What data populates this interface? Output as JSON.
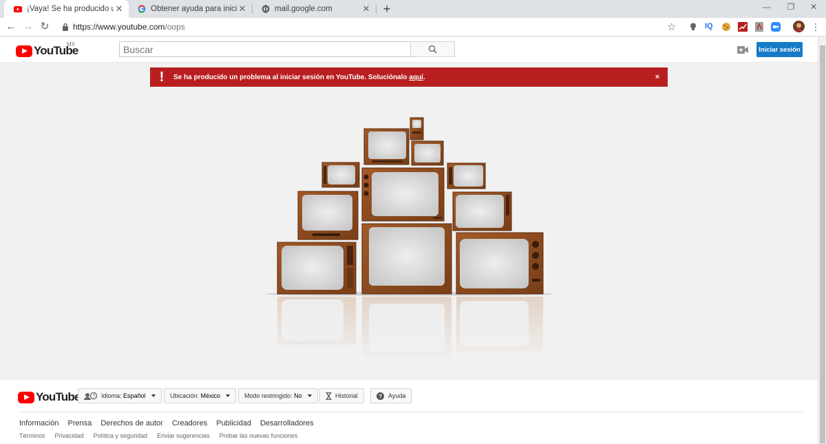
{
  "browser": {
    "tabs": [
      {
        "title": "¡Vaya! Se ha producido un error",
        "icon": "youtube-icon",
        "active": true
      },
      {
        "title": "Obtener ayuda para iniciar sesión",
        "icon": "google-icon",
        "active": false
      },
      {
        "title": "mail.google.com",
        "icon": "globe-icon",
        "active": false
      }
    ],
    "new_tab": "+",
    "url_main": "https://www.youtube.com",
    "url_path": "/oops",
    "extensions": [
      "lightbulb-icon",
      "iq-icon",
      "cookie-icon",
      "chart-icon",
      "pdf-icon",
      "zoom-icon",
      "avatar-icon"
    ],
    "ext_iq_label": "IQ"
  },
  "masthead": {
    "logo_word": "YouTube",
    "country": "MX",
    "search_placeholder": "Buscar",
    "signin_label": "Iniciar sesión"
  },
  "banner": {
    "icon": "!",
    "message_prefix": "Se ha producido un problema al iniciar sesión en YouTube. Soluciónalo ",
    "message_link": "aquí",
    "message_suffix": ".",
    "close": "×",
    "color": "#b91f20"
  },
  "footer": {
    "logo_word": "YouTube",
    "language_label": "Idioma:",
    "language_value": "Español",
    "location_label": "Ubicación:",
    "location_value": "México",
    "restricted_label": "Modo restringido:",
    "restricted_value": "No",
    "history_label": "Historial",
    "help_label": "Ayuda",
    "primary_links": [
      "Información",
      "Prensa",
      "Derechos de autor",
      "Creadores",
      "Publicidad",
      "Desarrolladores"
    ],
    "secondary_links": [
      "Términos",
      "Privacidad",
      "Política y seguridad",
      "Enviar sugerencias",
      "Probar las nuevas funciones"
    ]
  },
  "colors": {
    "brand_red": "#ff0000",
    "signin_blue": "#167ac6",
    "wood": "#8b4a1e"
  }
}
